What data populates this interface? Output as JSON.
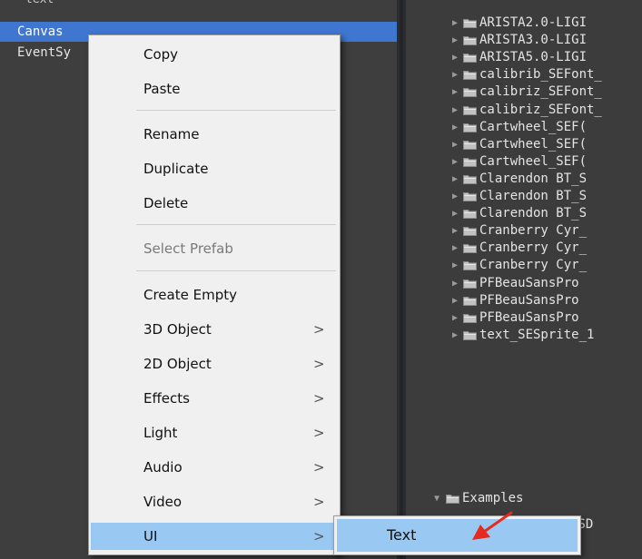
{
  "hierarchy": {
    "cut_row": "text",
    "rows": [
      {
        "label": "Canvas",
        "selected": true
      },
      {
        "label": "EventSy",
        "selected": false
      }
    ]
  },
  "project": {
    "items": [
      {
        "label": "ARISTA2.0-LIGI"
      },
      {
        "label": "ARISTA3.0-LIGI"
      },
      {
        "label": "ARISTA5.0-LIGI"
      },
      {
        "label": "calibrib_SEFont_"
      },
      {
        "label": "calibriz_SEFont_"
      },
      {
        "label": "calibriz_SEFont_"
      },
      {
        "label": "Cartwheel_SEF("
      },
      {
        "label": "Cartwheel_SEF("
      },
      {
        "label": "Cartwheel_SEF("
      },
      {
        "label": "Clarendon BT_S"
      },
      {
        "label": "Clarendon BT_S"
      },
      {
        "label": "Clarendon BT_S"
      },
      {
        "label": "Cranberry Cyr_"
      },
      {
        "label": "Cranberry Cyr_"
      },
      {
        "label": "Cranberry Cyr_"
      },
      {
        "label": "PFBeauSansPro"
      },
      {
        "label": "PFBeauSansPro"
      },
      {
        "label": "PFBeauSansPro"
      },
      {
        "label": "text_SESprite_1"
      }
    ],
    "examples_label": "Examples",
    "psd_label": "PSD"
  },
  "context_menu": {
    "copy": "Copy",
    "paste": "Paste",
    "rename": "Rename",
    "duplicate": "Duplicate",
    "delete": "Delete",
    "select_prefab": "Select Prefab",
    "create_empty": "Create Empty",
    "object_3d": "3D Object",
    "object_2d": "2D Object",
    "effects": "Effects",
    "light": "Light",
    "audio": "Audio",
    "video": "Video",
    "ui": "UI",
    "chevron": ">"
  },
  "submenu": {
    "text": "Text"
  },
  "icons": {
    "folder": "folder-icon",
    "expand": "expand-arrow-icon",
    "annotation": "red-arrow-annotation"
  },
  "colors": {
    "selection": "#3f76d0",
    "menu_highlight": "#99c9f2",
    "annotation_arrow": "#e52a1f"
  }
}
